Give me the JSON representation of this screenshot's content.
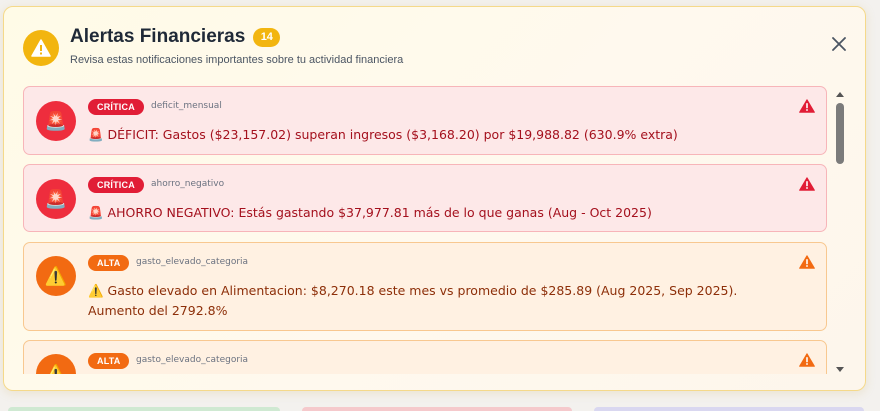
{
  "colors": {
    "critical": "#e11d36",
    "high": "#f26a12",
    "warning_yellow": "#f2b50f"
  },
  "header": {
    "icon": "warning-icon",
    "title": "Alertas Financieras",
    "count": "14",
    "subtitle": "Revisa estas notificaciones importantes sobre tu actividad financiera",
    "close_icon": "close-icon"
  },
  "alerts": [
    {
      "severity": "CRÍTICA",
      "category": "deficit_mensual",
      "icon": "siren-icon",
      "message": "🚨 DÉFICIT: Gastos ($23,157.02) superan ingresos ($3,168.20) por $19,988.82 (630.9% extra)"
    },
    {
      "severity": "CRÍTICA",
      "category": "ahorro_negativo",
      "icon": "siren-icon",
      "message": "🚨 AHORRO NEGATIVO: Estás gastando $37,977.81 más de lo que ganas (Aug - Oct 2025)"
    },
    {
      "severity": "ALTA",
      "category": "gasto_elevado_categoria",
      "icon": "warning-icon",
      "message": "⚠️ Gasto elevado en Alimentacion: $8,270.18 este mes vs promedio de $285.89 (Aug 2025, Sep 2025). Aumento del 2792.8%"
    },
    {
      "severity": "ALTA",
      "category": "gasto_elevado_categoria",
      "icon": "warning-icon",
      "message": ""
    }
  ]
}
